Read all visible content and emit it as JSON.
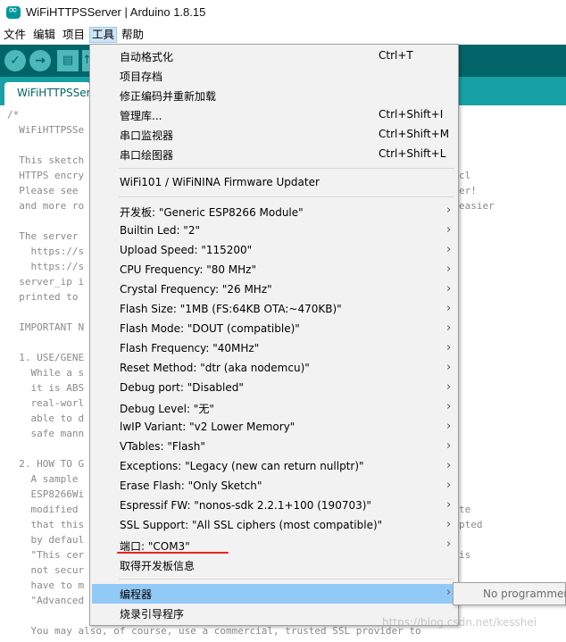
{
  "window": {
    "title": "WiFiHTTPSServer | Arduino 1.8.15"
  },
  "menubar": [
    {
      "label": "文件"
    },
    {
      "label": "编辑"
    },
    {
      "label": "项目"
    },
    {
      "label": "工具",
      "active": true
    },
    {
      "label": "帮助"
    }
  ],
  "toolbar": {
    "verify_glyph": "✓",
    "upload_glyph": "→",
    "new_glyph": "▤",
    "open_glyph": "↑"
  },
  "tab": {
    "label": "WiFiHTTPSServer"
  },
  "editor": {
    "lines": [
      "/*",
      "  WiFiHTTPSSe",
      "",
      "  This sketch",
      "  HTTPS encry",
      "  Please see",
      "  and more ro",
      "",
      "  The server",
      "    https://s",
      "    https://s",
      "  server_ip i",
      "  printed to",
      "",
      "  IMPORTANT N",
      "",
      "  1. USE/GENE",
      "    While a s",
      "    it is ABS",
      "    real-worl",
      "    able to d",
      "    safe mann",
      "",
      "  2. HOW TO G",
      "    A sample",
      "    ESP8266Wi",
      "    modified",
      "    that this",
      "    by defaul",
      "    \"This cer",
      "    not secur",
      "    have to m",
      "    \"Advanced",
      "",
      "    You may also, of course, use a commercial, trusted SSL provider to"
    ],
    "right_fragments": [
      {
        "line": 4,
        "text": "cl"
      },
      {
        "line": 5,
        "text": "er!"
      },
      {
        "line": 6,
        "text": "easier"
      },
      {
        "line": 26,
        "text": "te"
      },
      {
        "line": 27,
        "text": "pted"
      },
      {
        "line": 29,
        "text": "is"
      }
    ]
  },
  "tools_menu": {
    "items": [
      {
        "label": "自动格式化",
        "shortcut": "Ctrl+T",
        "arrow": false
      },
      {
        "label": "项目存档",
        "shortcut": "",
        "arrow": false
      },
      {
        "label": "修正编码并重新加载",
        "shortcut": "",
        "arrow": false
      },
      {
        "label": "管理库...",
        "shortcut": "Ctrl+Shift+I",
        "arrow": false
      },
      {
        "label": "串口监视器",
        "shortcut": "Ctrl+Shift+M",
        "arrow": false
      },
      {
        "label": "串口绘图器",
        "shortcut": "Ctrl+Shift+L",
        "arrow": false
      },
      {
        "separator": true
      },
      {
        "label": "WiFi101 / WiFiNINA Firmware Updater",
        "shortcut": "",
        "arrow": false
      },
      {
        "separator": true
      },
      {
        "label": "开发板: \"Generic ESP8266 Module\"",
        "shortcut": "",
        "arrow": true
      },
      {
        "label": "Builtin Led: \"2\"",
        "shortcut": "",
        "arrow": true
      },
      {
        "label": "Upload Speed: \"115200\"",
        "shortcut": "",
        "arrow": true
      },
      {
        "label": "CPU Frequency: \"80 MHz\"",
        "shortcut": "",
        "arrow": true
      },
      {
        "label": "Crystal Frequency: \"26 MHz\"",
        "shortcut": "",
        "arrow": true
      },
      {
        "label": "Flash Size: \"1MB (FS:64KB OTA:~470KB)\"",
        "shortcut": "",
        "arrow": true
      },
      {
        "label": "Flash Mode: \"DOUT (compatible)\"",
        "shortcut": "",
        "arrow": true
      },
      {
        "label": "Flash Frequency: \"40MHz\"",
        "shortcut": "",
        "arrow": true
      },
      {
        "label": "Reset Method: \"dtr (aka nodemcu)\"",
        "shortcut": "",
        "arrow": true
      },
      {
        "label": "Debug port: \"Disabled\"",
        "shortcut": "",
        "arrow": true
      },
      {
        "label": "Debug Level: \"无\"",
        "shortcut": "",
        "arrow": true
      },
      {
        "label": "lwIP Variant: \"v2 Lower Memory\"",
        "shortcut": "",
        "arrow": true
      },
      {
        "label": "VTables: \"Flash\"",
        "shortcut": "",
        "arrow": true
      },
      {
        "label": "Exceptions: \"Legacy (new can return nullptr)\"",
        "shortcut": "",
        "arrow": true
      },
      {
        "label": "Erase Flash: \"Only Sketch\"",
        "shortcut": "",
        "arrow": true
      },
      {
        "label": "Espressif FW: \"nonos-sdk 2.2.1+100 (190703)\"",
        "shortcut": "",
        "arrow": true
      },
      {
        "label": "SSL Support: \"All SSL ciphers (most compatible)\"",
        "shortcut": "",
        "arrow": true
      },
      {
        "label": "端口: \"COM3\"",
        "shortcut": "",
        "arrow": true
      },
      {
        "label": "取得开发板信息",
        "shortcut": "",
        "arrow": false
      },
      {
        "separator": true
      },
      {
        "label": "编程器",
        "shortcut": "",
        "arrow": true,
        "highlighted": true
      },
      {
        "label": "烧录引导程序",
        "shortcut": "",
        "arrow": false
      }
    ],
    "arrow_glyph": "›"
  },
  "submenu": {
    "label": "No programmer"
  },
  "watermark": "https://blog.csdn.net/kesshei",
  "colors": {
    "toolbar_bg": "#006468",
    "tabstrip_bg": "#17a1a5",
    "menu_bg": "#f2f2f2",
    "menu_highlight": "#91c9f7",
    "annotation_red": "#e8231f"
  }
}
